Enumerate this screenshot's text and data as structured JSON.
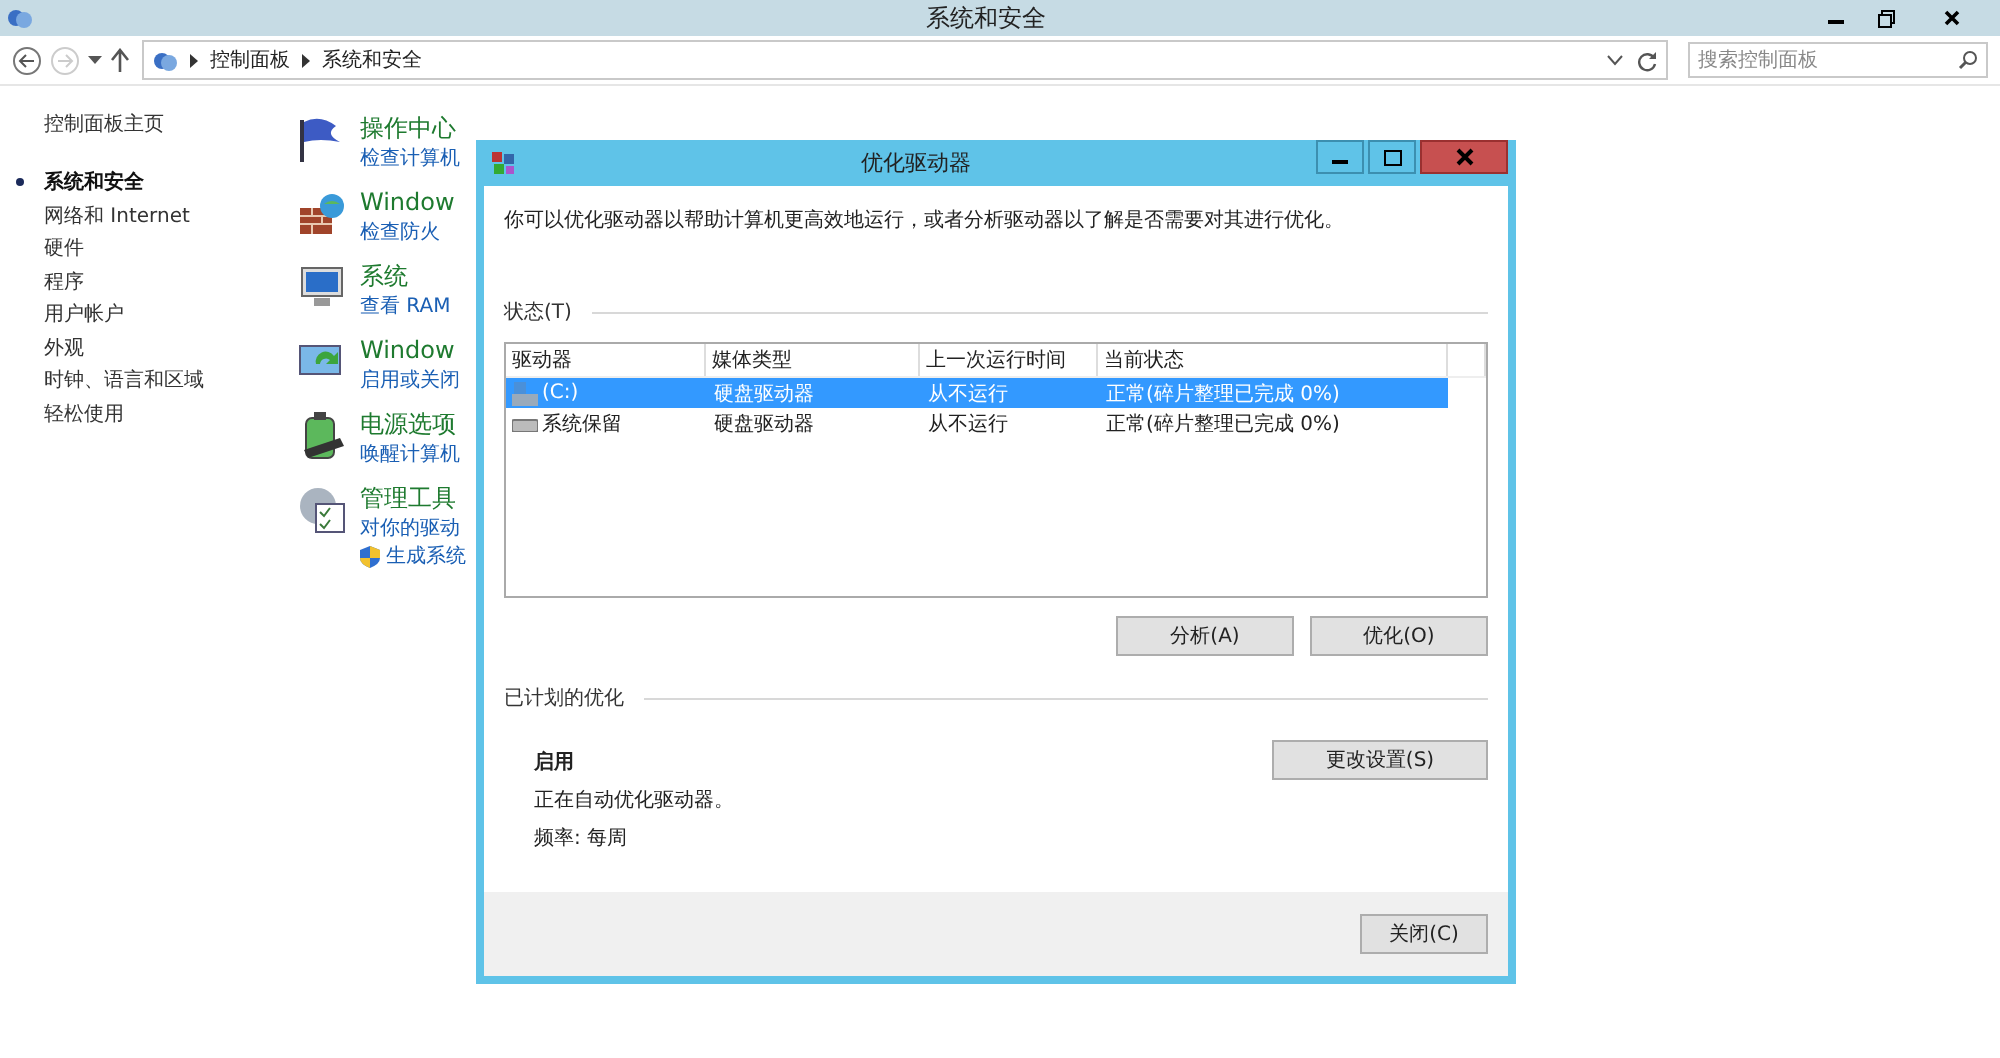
{
  "window": {
    "title": "系统和安全"
  },
  "address": {
    "breadcrumbs": [
      "控制面板",
      "系统和安全"
    ],
    "search_placeholder": "搜索控制面板"
  },
  "sidebar": {
    "home": "控制面板主页",
    "items": [
      {
        "label": "系统和安全",
        "selected": true
      },
      {
        "label": "网络和 Internet",
        "selected": false
      },
      {
        "label": "硬件",
        "selected": false
      },
      {
        "label": "程序",
        "selected": false
      },
      {
        "label": "用户帐户",
        "selected": false
      },
      {
        "label": "外观",
        "selected": false
      },
      {
        "label": "时钟、语言和区域",
        "selected": false
      },
      {
        "label": "轻松使用",
        "selected": false
      }
    ]
  },
  "categories": [
    {
      "kind": "flag",
      "title": "操作中心",
      "link": "检查计算机"
    },
    {
      "kind": "firewall",
      "title": "Window",
      "link": "检查防火"
    },
    {
      "kind": "monitor",
      "title": "系统",
      "link": "查看 RAM"
    },
    {
      "kind": "update",
      "title": "Window",
      "link": "启用或关闭"
    },
    {
      "kind": "battery",
      "title": "电源选项",
      "link": "唤醒计算机"
    },
    {
      "kind": "tools",
      "title": "管理工具",
      "link": "对你的驱动",
      "shield_link": "生成系统"
    }
  ],
  "dialog": {
    "title": "优化驱动器",
    "description": "你可以优化驱动器以帮助计算机更高效地运行，或者分析驱动器以了解是否需要对其进行优化。",
    "status_label": "状态(T)",
    "columns": [
      "驱动器",
      "媒体类型",
      "上一次运行时间",
      "当前状态"
    ],
    "rows": [
      {
        "kind": "system",
        "cells": [
          "(C:)",
          "硬盘驱动器",
          "从不运行",
          "正常(碎片整理已完成 0%)"
        ],
        "selected": true
      },
      {
        "kind": "disk",
        "cells": [
          "系统保留",
          "硬盘驱动器",
          "从不运行",
          "正常(碎片整理已完成 0%)"
        ],
        "selected": false
      }
    ],
    "analyze_button": "分析(A)",
    "optimize_button": "优化(O)",
    "scheduled_label": "已计划的优化",
    "schedule_state": "启用",
    "schedule_text": "正在自动优化驱动器。",
    "frequency": "频率: 每周",
    "settings_button": "更改设置(S)",
    "close_button": "关闭(C)"
  }
}
